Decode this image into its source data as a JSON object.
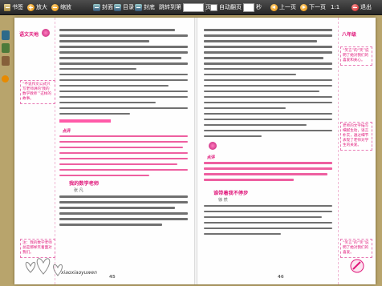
{
  "toolbar": {
    "bookshelf_label": "书签",
    "zoom_in_label": "放大",
    "restore_label": "缩放",
    "cover_label": "封面",
    "contents_label": "目录",
    "back_cover_label": "封底",
    "page_jump_label": "跳转到第",
    "page_jump_value": "",
    "page_unit": "页",
    "auto_flip_label": "自动翻页",
    "auto_flip_seconds": "",
    "seconds_unit": "秒",
    "prev_label": "上一页",
    "next_label": "下一页",
    "zoom_ratio": "1:1",
    "exit_label": "退出"
  },
  "left_page": {
    "header_tag": "语文天地",
    "note_top": "“不说作文公式只写老师讲的‘我的数学教师’”这样的故事。",
    "note_bottom": "注：我的数学老师总是那样笑着面对我们。",
    "section_label": "点评",
    "article_title": "我的数学老师",
    "article_author": "张 凡",
    "footer_text": "xiaoxiaoyuwen",
    "page_number": "45"
  },
  "right_page": {
    "header_tag": "八年级",
    "note_top": "“笑言”的“笑”说明了她对我们的喜爱和关心。",
    "note_middle": "老师的文字描写细腻生动，语言朴实，通过细节表现了老师对学生的关爱。",
    "note_bottom": "“笑言”的“笑”说明了她对我们的喜爱。",
    "section_label": "点评",
    "article_title": "谁带着我不停步",
    "article_author": "徐 然",
    "page_number": "46"
  }
}
